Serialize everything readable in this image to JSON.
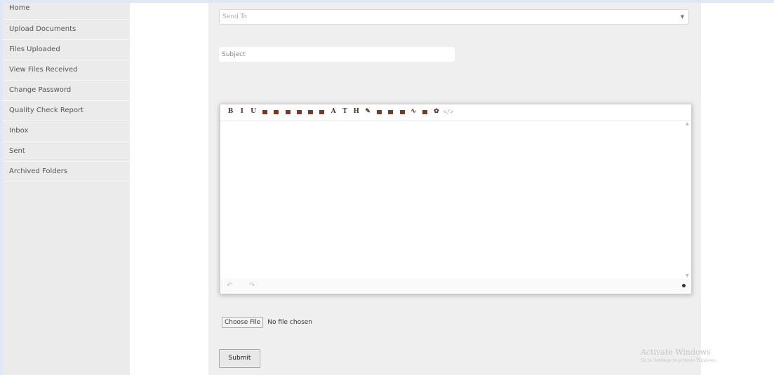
{
  "sidebar": {
    "items": [
      {
        "label": "Home"
      },
      {
        "label": "Upload Documents"
      },
      {
        "label": "Files Uploaded"
      },
      {
        "label": "View Files Received"
      },
      {
        "label": "Change Password"
      },
      {
        "label": "Quality Check Report"
      },
      {
        "label": "Inbox"
      },
      {
        "label": "Sent"
      },
      {
        "label": "Archived Folders"
      }
    ]
  },
  "form": {
    "send_to_placeholder": "Send To",
    "subject_placeholder": "Subject",
    "choose_file_label": "Choose File",
    "no_file_text": "No file chosen",
    "submit_label": "Submit"
  },
  "editor": {
    "toolbar": [
      {
        "icon": "bold-icon",
        "glyph": "B"
      },
      {
        "icon": "italic-icon",
        "glyph": "I"
      },
      {
        "icon": "underline-icon",
        "glyph": "U"
      },
      {
        "icon": "align-left-icon",
        "glyph": ""
      },
      {
        "icon": "align-center-icon",
        "glyph": ""
      },
      {
        "icon": "align-right-icon",
        "glyph": ""
      },
      {
        "icon": "justify-icon",
        "glyph": ""
      },
      {
        "icon": "ordered-list-icon",
        "glyph": ""
      },
      {
        "icon": "unordered-list-icon",
        "glyph": ""
      },
      {
        "icon": "font-icon",
        "glyph": "A"
      },
      {
        "icon": "font-size-icon",
        "glyph": "T"
      },
      {
        "icon": "heading-icon",
        "glyph": "H"
      },
      {
        "icon": "brush-icon",
        "glyph": "✎"
      },
      {
        "icon": "image-icon",
        "glyph": ""
      },
      {
        "icon": "file-icon",
        "glyph": ""
      },
      {
        "icon": "video-icon",
        "glyph": ""
      },
      {
        "icon": "link-icon",
        "glyph": "∿"
      },
      {
        "icon": "table-icon",
        "glyph": ""
      },
      {
        "icon": "settings-icon",
        "glyph": "✿"
      },
      {
        "icon": "source-code-icon",
        "glyph": "</>"
      }
    ],
    "footer": {
      "undo_glyph": "↶",
      "redo_glyph": "↷"
    }
  },
  "watermark": {
    "line1": "Activate Windows",
    "line2": "Go to Settings to activate Windows."
  }
}
